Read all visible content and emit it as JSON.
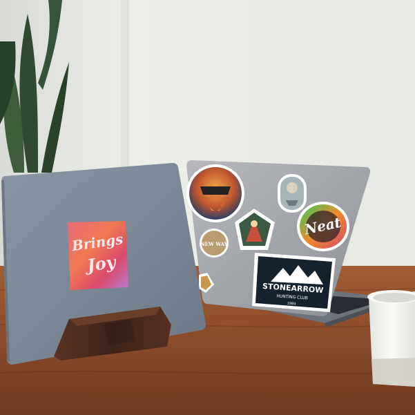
{
  "stickers": {
    "brings_joy": {
      "line1": "Brings",
      "line2": "Joy"
    },
    "neat": {
      "text": "Neat"
    },
    "badge": {
      "text": "NEW WAY"
    },
    "stonearrow": {
      "title": "STONEARROW",
      "subtitle": "HUNTING CLUB",
      "year": "1984"
    }
  },
  "colors": {
    "wall": "#e9ebe6",
    "table": "#8a4b2a",
    "laptop_left": "#7b8794",
    "laptop_right": "#9ea1a6",
    "stand": "#4a2b1d",
    "mug": "#f2f2ef"
  }
}
